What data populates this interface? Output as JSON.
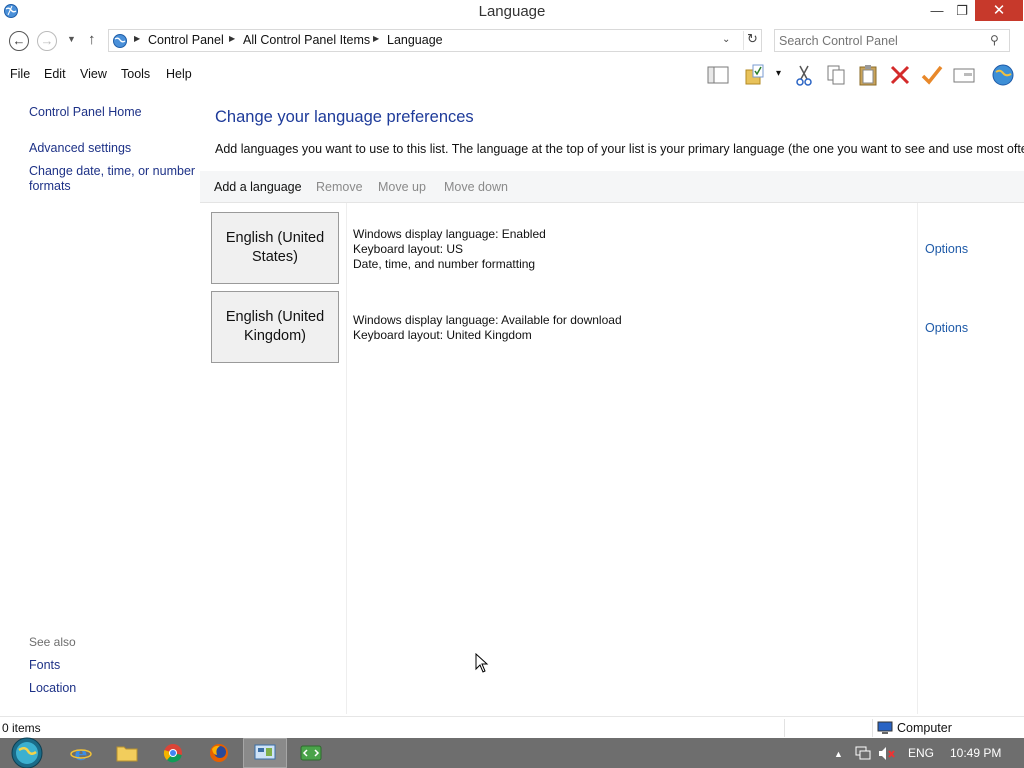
{
  "window": {
    "title": "Language",
    "minimize_glyph": "—",
    "maximize_glyph": "❐",
    "close_glyph": "✕"
  },
  "address_bar": {
    "back_glyph": "←",
    "forward_glyph": "→",
    "recent_glyph": "▼",
    "up_glyph": "↑",
    "crumbs": [
      "Control Panel",
      "All Control Panel Items",
      "Language"
    ],
    "crumb_sep_glyph": "▶",
    "dropdown_glyph": "⌄",
    "refresh_glyph": "↻",
    "search_placeholder": "Search Control Panel",
    "search_glyph": "⚲"
  },
  "menu": {
    "items": [
      "File",
      "Edit",
      "View",
      "Tools",
      "Help"
    ],
    "dropdown_glyph": "▾"
  },
  "toolbar_icons": [
    "layout-pane-icon",
    "folder-checkmark-icon",
    "cut-icon",
    "copy-icon",
    "paste-icon",
    "delete-icon",
    "checkmark-icon",
    "properties-icon",
    "globe-icon"
  ],
  "sidebar": {
    "home": "Control Panel Home",
    "advanced": "Advanced settings",
    "date_time_1": "Change date, time, or number",
    "date_time_2": "formats",
    "see_also": "See also",
    "fonts": "Fonts",
    "location": "Location"
  },
  "main": {
    "heading": "Change your language preferences",
    "description": "Add languages you want to use to this list. The language at the top of your list is your primary language (the one you want to see and use most often).",
    "commands": {
      "add": "Add a language",
      "remove": "Remove",
      "move_up": "Move up",
      "move_down": "Move down"
    },
    "languages": [
      {
        "name_1": "English (United",
        "name_2": "States)",
        "info_1": "Windows display language: Enabled",
        "info_2": "Keyboard layout: US",
        "info_3": "Date, time, and number formatting",
        "options": "Options"
      },
      {
        "name_1": "English (United",
        "name_2": "Kingdom)",
        "info_1": "Windows display language: Available for download",
        "info_2": "Keyboard layout: United Kingdom",
        "options": "Options"
      }
    ]
  },
  "status_bar": {
    "items": "0 items",
    "location": "Computer"
  },
  "taskbar": {
    "apps": [
      "internet-explorer-icon",
      "file-explorer-icon",
      "chrome-icon",
      "firefox-icon",
      "control-panel-icon",
      "remote-desktop-icon"
    ],
    "active_app": "control-panel-icon",
    "tray_up_glyph": "▲",
    "language": "ENG",
    "time": "10:49 PM"
  },
  "colors": {
    "link": "#1e3287",
    "heading": "#1e3b9a",
    "disabled": "#8a8a8a",
    "close_button": "#c7392b",
    "taskbar": "#6e6e6e"
  }
}
